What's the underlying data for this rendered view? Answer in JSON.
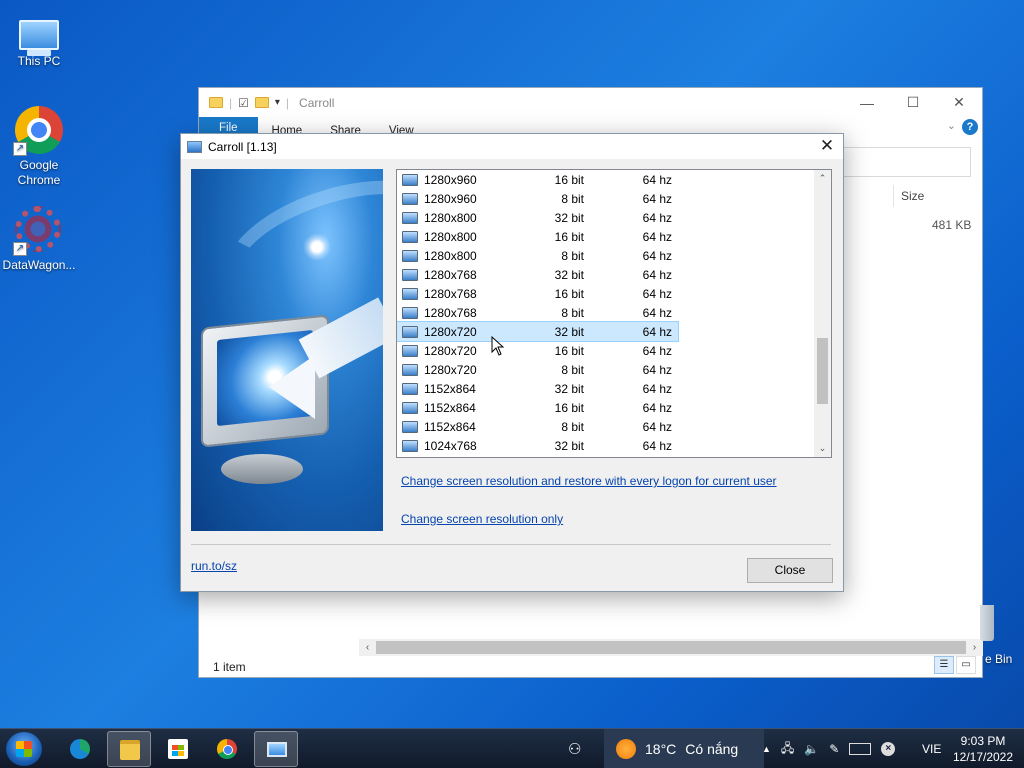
{
  "desktop": {
    "icons": [
      {
        "label": "This PC"
      },
      {
        "label": "Google Chrome"
      },
      {
        "label": "DataWagon..."
      }
    ],
    "recycle_label": "e Bin"
  },
  "explorer": {
    "title": "Carroll",
    "tabs": [
      "File",
      "Home",
      "Share",
      "View"
    ],
    "column_size": "Size",
    "file_size": "481 KB",
    "status": "1 item",
    "window_controls": {
      "minimize": "—",
      "maximize": "☐",
      "close": "✕"
    }
  },
  "dialog": {
    "title": "Carroll [1.13]",
    "rows": [
      {
        "res": "1280x960",
        "bits": "16 bit",
        "hz": "64 hz"
      },
      {
        "res": "1280x960",
        "bits": "8 bit",
        "hz": "64 hz"
      },
      {
        "res": "1280x800",
        "bits": "32 bit",
        "hz": "64 hz"
      },
      {
        "res": "1280x800",
        "bits": "16 bit",
        "hz": "64 hz"
      },
      {
        "res": "1280x800",
        "bits": "8 bit",
        "hz": "64 hz"
      },
      {
        "res": "1280x768",
        "bits": "32 bit",
        "hz": "64 hz"
      },
      {
        "res": "1280x768",
        "bits": "16 bit",
        "hz": "64 hz"
      },
      {
        "res": "1280x768",
        "bits": "8 bit",
        "hz": "64 hz"
      },
      {
        "res": "1280x720",
        "bits": "32 bit",
        "hz": "64 hz",
        "selected": true
      },
      {
        "res": "1280x720",
        "bits": "16 bit",
        "hz": "64 hz"
      },
      {
        "res": "1280x720",
        "bits": "8 bit",
        "hz": "64 hz"
      },
      {
        "res": "1152x864",
        "bits": "32 bit",
        "hz": "64 hz"
      },
      {
        "res": "1152x864",
        "bits": "16 bit",
        "hz": "64 hz"
      },
      {
        "res": "1152x864",
        "bits": "8 bit",
        "hz": "64 hz"
      },
      {
        "res": "1024x768",
        "bits": "32 bit",
        "hz": "64 hz"
      }
    ],
    "link_restore": "Change screen resolution and restore with every logon for current user",
    "link_only": "Change screen resolution only",
    "link_site": "run.to/sz",
    "close_label": "Close",
    "close_glyph": "✕"
  },
  "taskbar": {
    "weather_temp": "18°C",
    "weather_text": "Có nắng",
    "language": "VIE",
    "time": "9:03 PM",
    "date": "12/17/2022"
  },
  "colors": {
    "selection": "#cce8ff",
    "link": "#0645ad",
    "desktop": "#1d7fe0"
  }
}
